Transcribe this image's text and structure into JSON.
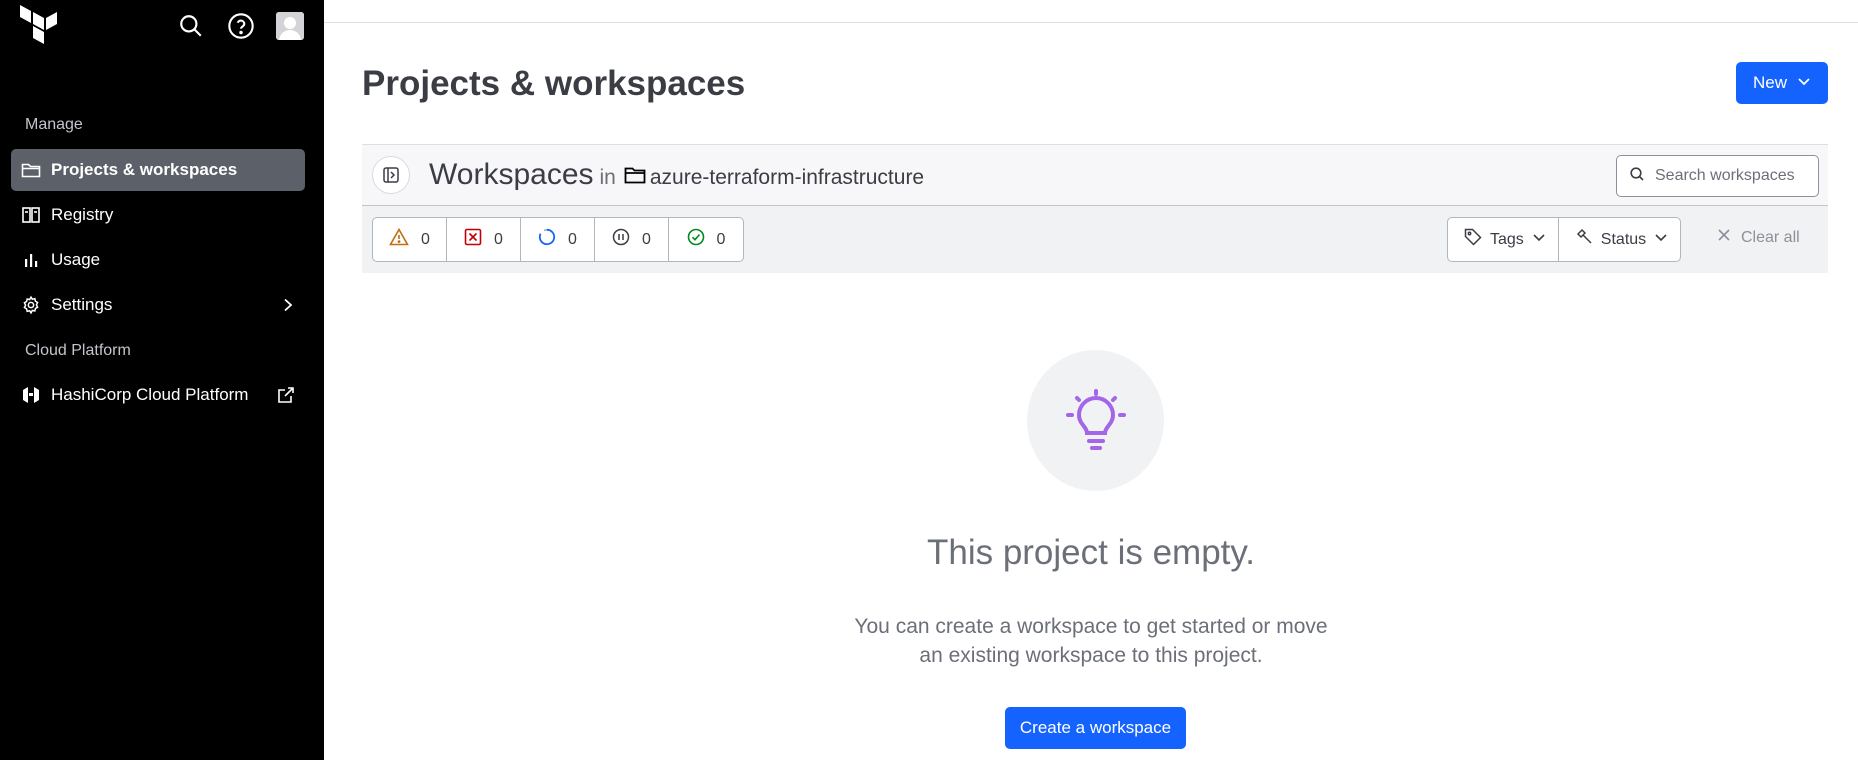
{
  "sidebar": {
    "sections": {
      "manage": "Manage",
      "cloud": "Cloud Platform"
    },
    "items": [
      {
        "label": "Projects & workspaces",
        "icon": "folder-icon"
      },
      {
        "label": "Registry",
        "icon": "book-icon"
      },
      {
        "label": "Usage",
        "icon": "bar-chart-icon"
      },
      {
        "label": "Settings",
        "icon": "gear-icon"
      },
      {
        "label": "HashiCorp Cloud Platform",
        "icon": "hashicorp-icon"
      }
    ]
  },
  "main": {
    "title": "Projects & workspaces",
    "new_button": "New",
    "workspaces_title": "Workspaces",
    "in_label": "in",
    "project_name": "azure-terraform-infrastructure",
    "search_placeholder": "Search workspaces",
    "status_counts": [
      {
        "icon": "warning-icon",
        "count": "0",
        "color": "#c26d13"
      },
      {
        "icon": "error-icon",
        "count": "0",
        "color": "#c00005"
      },
      {
        "icon": "running-icon",
        "count": "0",
        "color": "#1563ff"
      },
      {
        "icon": "paused-icon",
        "count": "0",
        "color": "#3b3d45"
      },
      {
        "icon": "success-icon",
        "count": "0",
        "color": "#008a22"
      }
    ],
    "filters": {
      "tags": "Tags",
      "status": "Status",
      "clear_all": "Clear all"
    },
    "empty_state": {
      "title": "This project is empty.",
      "desc_line1": "You can create a workspace to get started or move",
      "desc_line2": "an existing workspace to this project.",
      "button": "Create a workspace",
      "icon_color": "#a466e8"
    }
  }
}
